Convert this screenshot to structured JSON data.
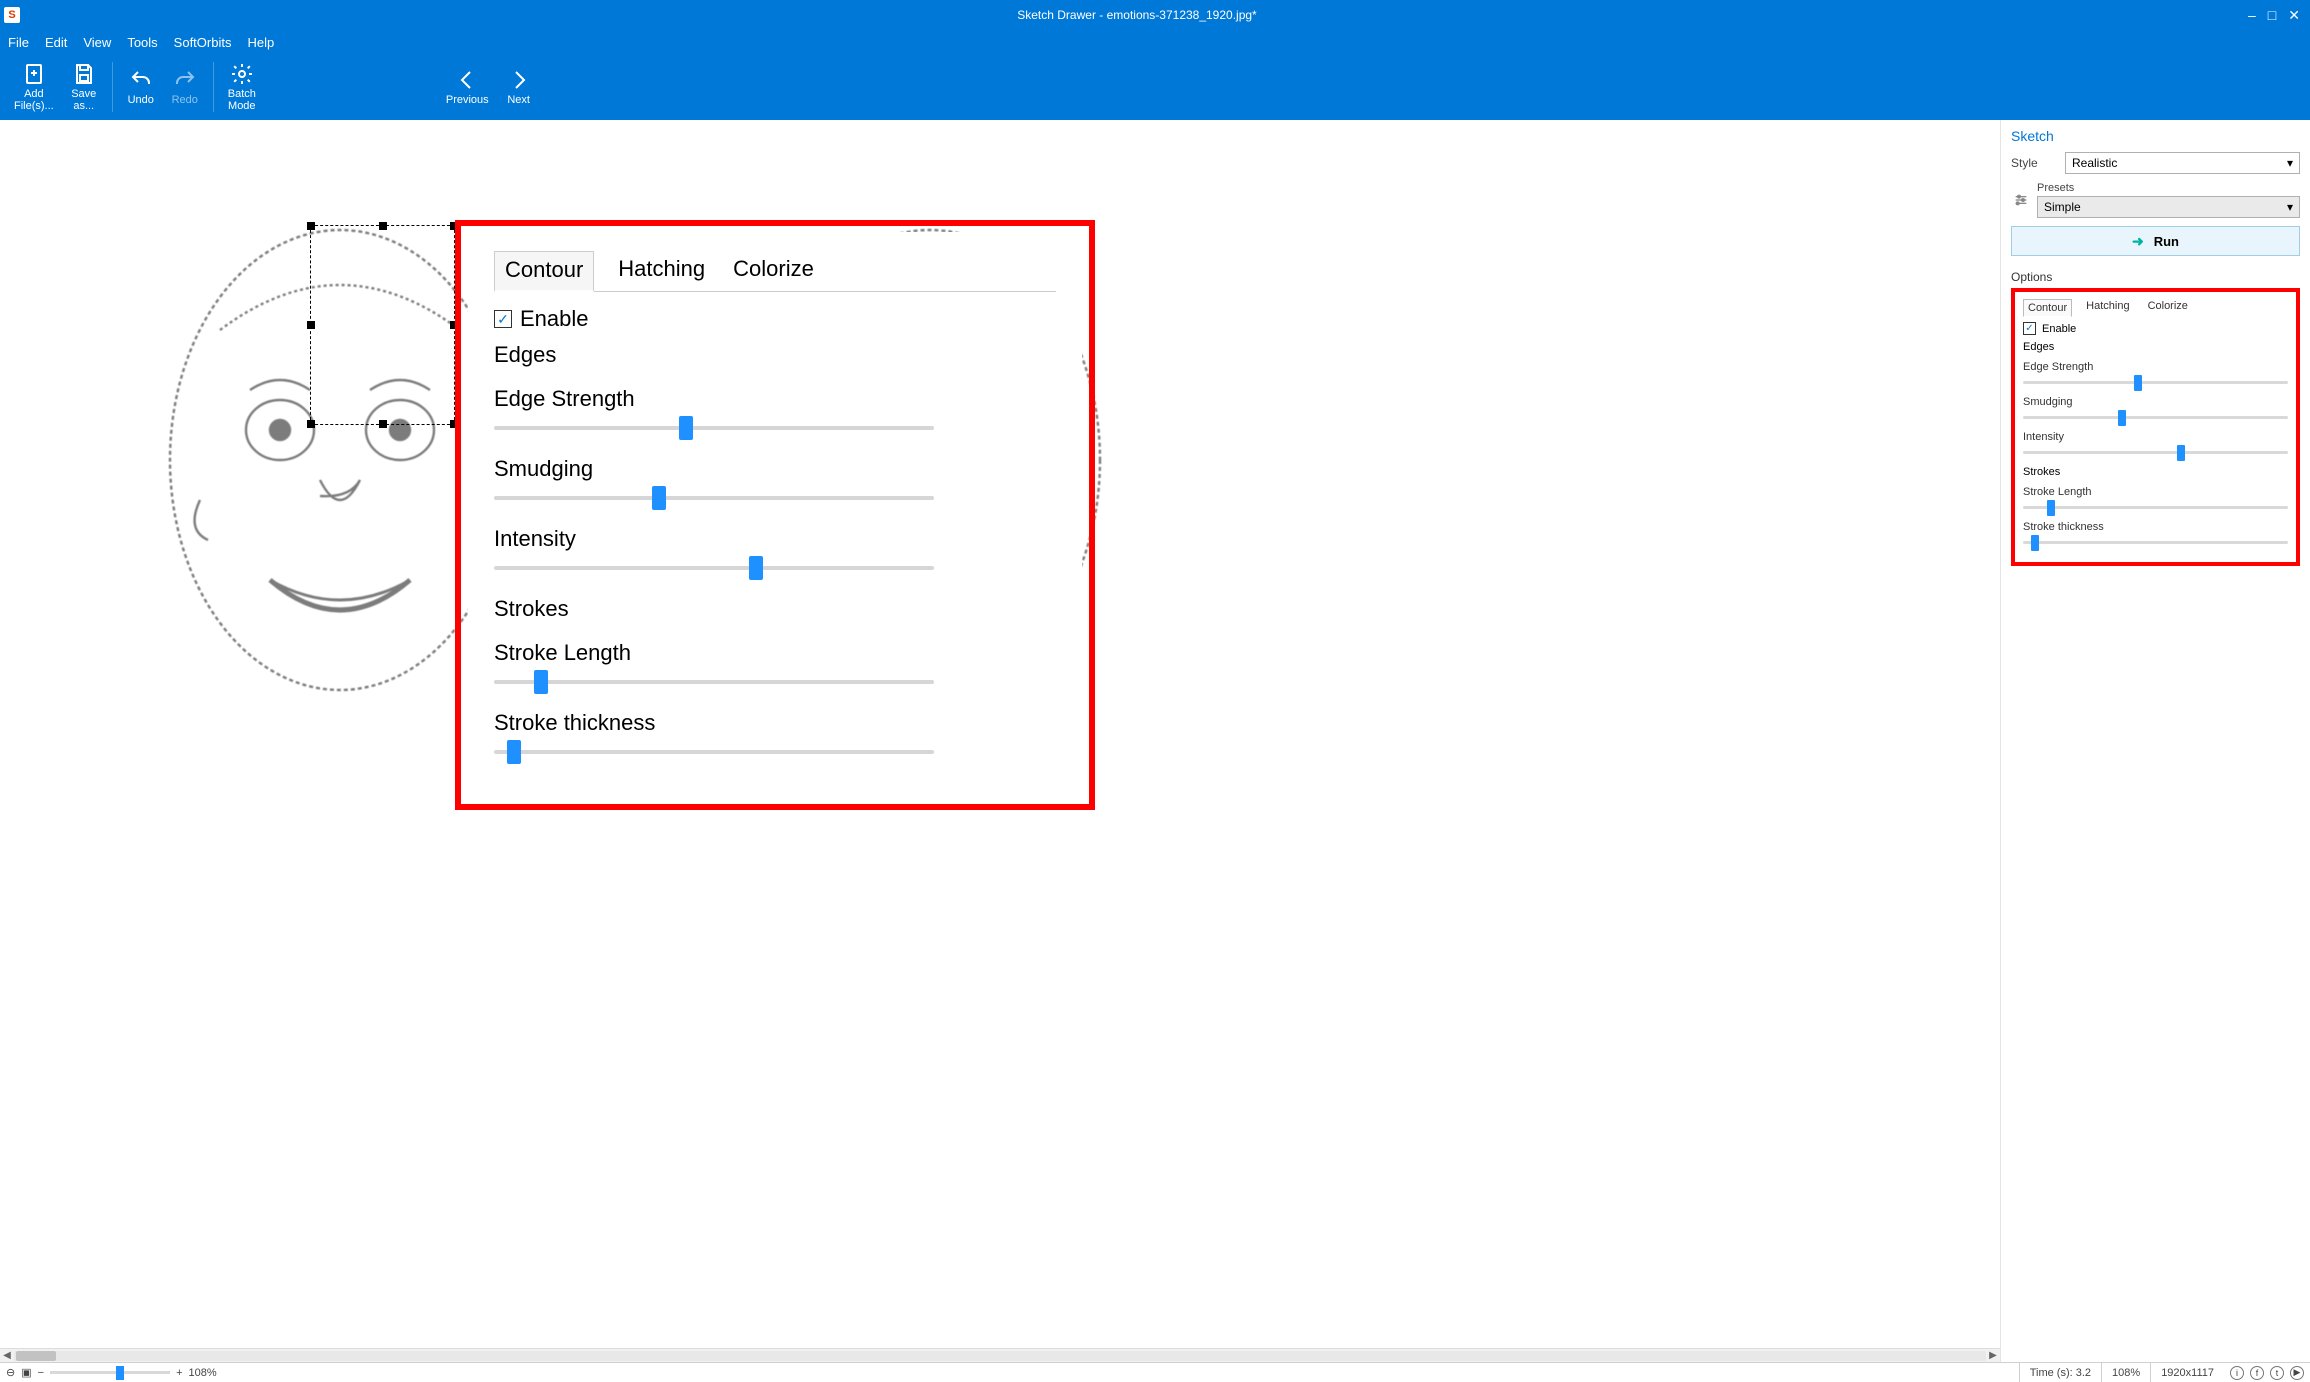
{
  "title": "Sketch Drawer - emotions-371238_1920.jpg*",
  "menu": [
    "File",
    "Edit",
    "View",
    "Tools",
    "SoftOrbits",
    "Help"
  ],
  "ribbon": {
    "add": "Add\nFile(s)...",
    "save": "Save\nas...",
    "undo": "Undo",
    "redo": "Redo",
    "batch": "Batch\nMode",
    "prev": "Previous",
    "next": "Next"
  },
  "zoom_panel": {
    "tabs": [
      "Contour",
      "Hatching",
      "Colorize"
    ],
    "active_tab": 0,
    "enable_label": "Enable",
    "enable_checked": true,
    "section_edges": "Edges",
    "section_strokes": "Strokes",
    "sliders": [
      {
        "label": "Edge Strength",
        "value": 42
      },
      {
        "label": "Smudging",
        "value": 36
      },
      {
        "label": "Intensity",
        "value": 58
      },
      {
        "label": "Stroke Length",
        "value": 9
      },
      {
        "label": "Stroke thickness",
        "value": 3
      }
    ]
  },
  "side": {
    "sketch_title": "Sketch",
    "style_label": "Style",
    "style_value": "Realistic",
    "presets_label": "Presets",
    "presets_value": "Simple",
    "run_label": "Run",
    "options_label": "Options",
    "tabs": [
      "Contour",
      "Hatching",
      "Colorize"
    ],
    "active_tab": 0,
    "enable_label": "Enable",
    "enable_checked": true,
    "sec_edges": "Edges",
    "sec_strokes": "Strokes",
    "sliders": [
      {
        "label": "Edge Strength",
        "value": 42
      },
      {
        "label": "Smudging",
        "value": 36
      },
      {
        "label": "Intensity",
        "value": 58
      },
      {
        "label": "Stroke Length",
        "value": 9
      },
      {
        "label": "Stroke thickness",
        "value": 3
      }
    ]
  },
  "status": {
    "zoom_pct": "108%",
    "time": "Time (s): 3.2",
    "zoom2": "108%",
    "dims": "1920x1117"
  }
}
